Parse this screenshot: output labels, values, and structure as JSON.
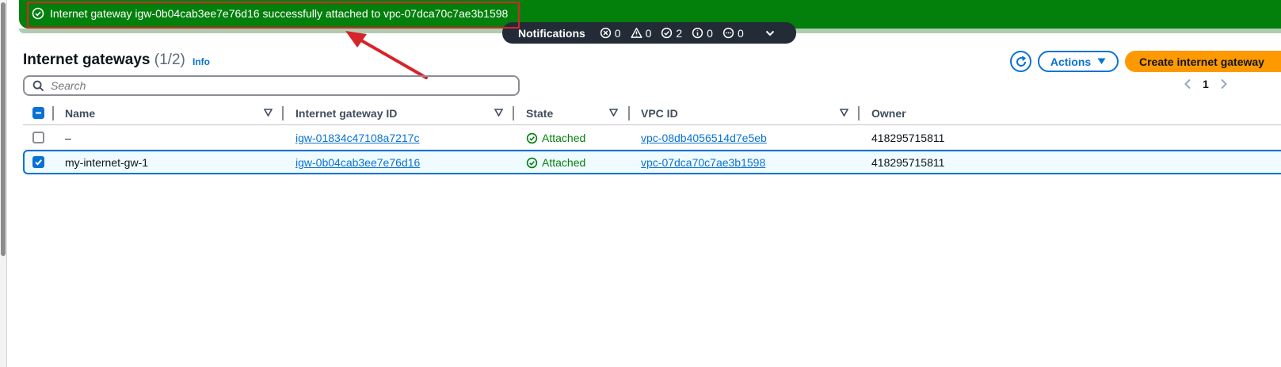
{
  "banner": {
    "message": "Internet gateway igw-0b04cab3ee7e76d16 successfully attached to vpc-07dca70c7ae3b1598"
  },
  "notifications": {
    "title": "Notifications",
    "error_count": "0",
    "warning_count": "0",
    "success_count": "2",
    "info_count": "0",
    "in_progress_count": "0"
  },
  "header": {
    "title": "Internet gateways",
    "count": "(1/2)",
    "info_label": "Info",
    "actions_label": "Actions",
    "create_label": "Create internet gateway"
  },
  "search": {
    "placeholder": "Search"
  },
  "pagination": {
    "current_page": "1"
  },
  "table": {
    "columns": [
      "Name",
      "Internet gateway ID",
      "State",
      "VPC ID",
      "Owner"
    ],
    "rows": [
      {
        "selected": false,
        "name": "–",
        "gateway_id": "igw-01834c47108a7217c",
        "state": "Attached",
        "vpc_id": "vpc-08db4056514d7e5eb",
        "owner": "418295715811"
      },
      {
        "selected": true,
        "name": "my-internet-gw-1",
        "gateway_id": "igw-0b04cab3ee7e76d16",
        "state": "Attached",
        "vpc_id": "vpc-07dca70c7ae3b1598",
        "owner": "418295715811"
      }
    ]
  },
  "colors": {
    "success": "#037f0c",
    "link": "#0972d3",
    "primary_button": "#ff9900",
    "annotation": "#d6242b"
  }
}
